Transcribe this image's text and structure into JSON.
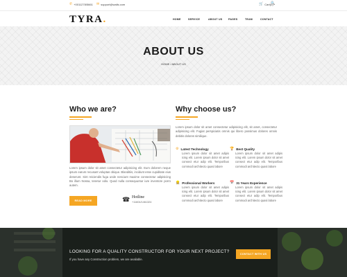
{
  "topbar": {
    "phone": "+0011278/5661",
    "email": "support@walls.com",
    "cart": "Cart(0)"
  },
  "brand": {
    "name": "TYRA",
    "dot": "."
  },
  "nav": {
    "items": [
      "HOME",
      "SERVICE",
      "ABOUT US",
      "PAGES",
      "TEAM",
      "CONTACT"
    ]
  },
  "hero": {
    "title": "ABOUT US",
    "breadcrumb_home": "HOME",
    "breadcrumb_sep": "/",
    "breadcrumb_current": "ABOUT US"
  },
  "who": {
    "heading": "Who we are?",
    "paragraph": "Lorem ipsum dolor sit amet consectetur adipisicing elit. Eum dolorem neque ipsum earum recusant voluptas obique. Blanditiis, incidunt esse cupiditate eius deserunt. Sint reiciendis fuga unde nesciunt maxime consectetur adipisicing Bo illum Nossa, tenetur odio. Quod nulla consequuntur iure inventore porro autem.",
    "read_more": "READ MORE",
    "hotline_label": "Hotline",
    "hotline_number": "+11604/1461324"
  },
  "why": {
    "heading": "Why choose us?",
    "paragraph": "Lorem ipsum dolor sit amet consectetur adipisicing elit, sit amet, consectetur adipisicing elit. Fugiat perspiciatis omnis qui libero possimus dolores omnis debitis dolores similique.",
    "features": [
      {
        "title": "Latest Technology",
        "text": "Lorem ipsum dolor sit amet adipis icing elit. Lorem ipsum dolor sit amet consect etur adip elit. Temporibus commodi architecto quasi labore"
      },
      {
        "title": "Best Quality",
        "text": "Lorem ipsum dolor sit amet adipis icing elit. Lorem ipsum dolor sit amet consect etur adip elit. Temporibus commodi architecto quasi labore"
      },
      {
        "title": "Professional Workers",
        "text": "Lorem ipsum dolor sit amet adipis icing elit. Lorem ipsum dolor sit amet consect etur adip elit. Temporibus commodi architecto quasi labore"
      },
      {
        "title": "31 Years Experience",
        "text": "Lorem ipsum dolor sit amet adipis icing elit. Lorem ipsum dolor sit amet consect etur adip elit. Temporibus commodi architecto quasi labore"
      }
    ]
  },
  "cta": {
    "headline": "LOOKING FOR A QUALITY CONSTRUCTOR FOR YOUR NEXT PROJECT?",
    "subtext": "If you have any Construction problem, we are available.",
    "button": "CONTACT WITH US"
  },
  "icons": {
    "phone": "phone-icon",
    "email": "envelope-icon",
    "cart": "cart-icon",
    "search": "search-icon",
    "hotline": "telephone-icon",
    "feature": [
      "chip-icon",
      "trophy-icon",
      "worker-icon",
      "calendar-icon"
    ]
  },
  "colors": {
    "accent": "#f5a623",
    "dark": "#1f2420",
    "hero_bg": "#f3f3f3"
  }
}
